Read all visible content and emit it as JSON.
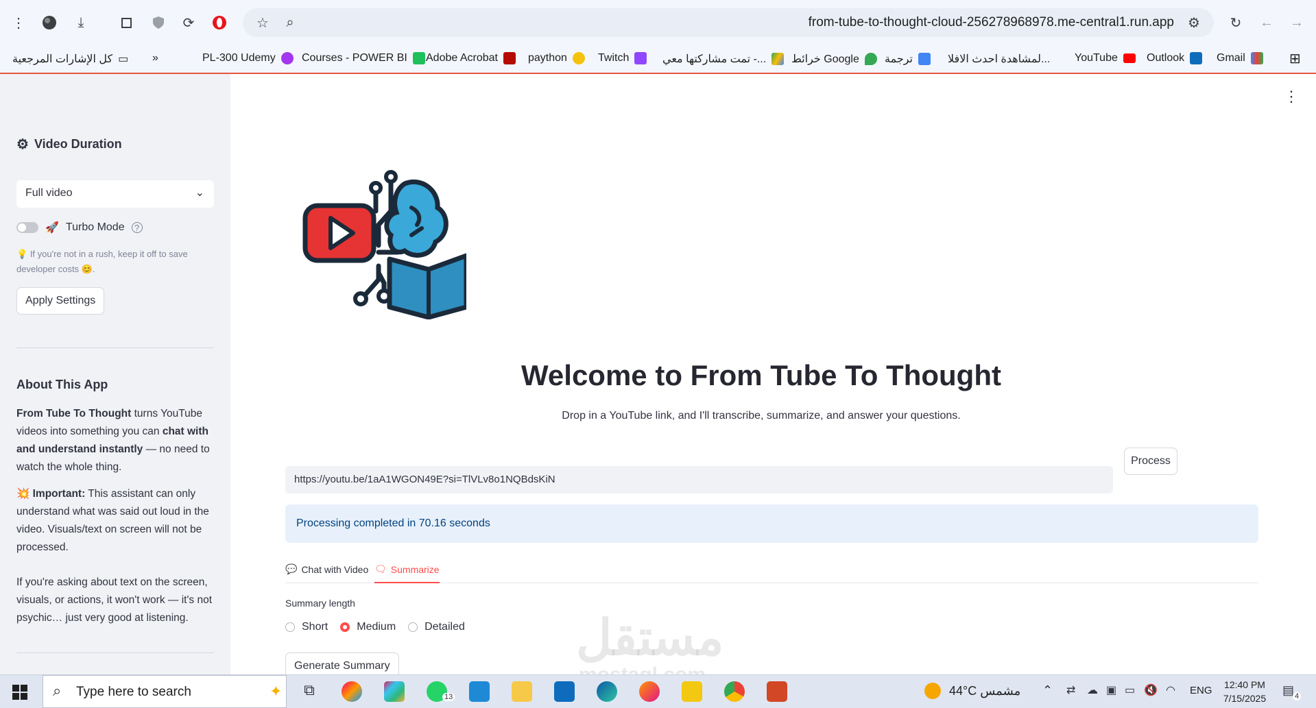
{
  "browser": {
    "url": "from-tube-to-thought-cloud-256278968978.me-central1.run.app",
    "bookmarks": [
      {
        "label": "Gmail",
        "color": "#ea4335"
      },
      {
        "label": "Outlook",
        "color": "#0f6cbd"
      },
      {
        "label": "YouTube",
        "color": "#ff0000"
      },
      {
        "label": "لمشاهدة احدث الافلا...",
        "color": ""
      },
      {
        "label": "ترجمة",
        "color": "#4285f4"
      },
      {
        "label": "خرائط Google",
        "color": "#34a853"
      },
      {
        "label": "تمت مشاركتها معي -...",
        "color": "#fbbc04"
      },
      {
        "label": "Twitch",
        "color": "#9146ff"
      },
      {
        "label": "paython",
        "color": "#f4c20d"
      },
      {
        "label": "Adobe Acrobat",
        "color": "#b30b00"
      },
      {
        "label": "Courses - POWER BI",
        "color": "#1fbf5b"
      },
      {
        "label": "PL-300 Udemy",
        "color": "#a435f0"
      }
    ],
    "all_bookmarks_label": "كل الإشارات المرجعية"
  },
  "sidebar": {
    "duration_title": "Video Duration",
    "duration_value": "Full video",
    "turbo_label": "Turbo Mode",
    "turbo_hint": "If you're not in a rush, keep it off to save developer costs",
    "apply_label": "Apply Settings",
    "about_title": "About This App",
    "about_p1_bold": "From Tube To Thought",
    "about_p1_a": " turns YouTube videos into something you can ",
    "about_p1_bold2": "chat with and understand instantly",
    "about_p1_b": " — no need to watch the whole thing.",
    "about_p2_bold": "Important:",
    "about_p2": " This assistant can only understand what was said out loud in the video. Visuals/text on screen will not be processed.",
    "about_p3": "If you're asking about text on the screen, visuals, or actions, it won't work — it's not psychic… just very good at listening."
  },
  "main": {
    "welcome": "Welcome to From Tube To Thought",
    "subtitle": "Drop in a YouTube link, and I'll transcribe, summarize, and answer your questions.",
    "url_value": "https://youtu.be/1aA1WGON49E?si=TlVLv8o1NQBdsKiN",
    "process_label": "Process",
    "success": "Processing completed in 70.16 seconds",
    "tabs": [
      {
        "label": "Chat with Video",
        "active": false
      },
      {
        "label": "Summarize",
        "active": true
      }
    ],
    "summary_length_label": "Summary length",
    "radio_options": [
      {
        "label": "Short",
        "selected": false
      },
      {
        "label": "Medium",
        "selected": true
      },
      {
        "label": "Detailed",
        "selected": false
      }
    ],
    "generate_label": "Generate Summary",
    "watermark": "مستقل",
    "watermark_sub": "mostaql.com"
  },
  "taskbar": {
    "search_placeholder": "Type here to search",
    "weather": "44°C مشمس",
    "lang": "ENG",
    "time": "12:40 PM",
    "date": "7/15/2025",
    "notification_count": "4",
    "whatsapp_badge": "13"
  },
  "colors": {
    "accent": "#ff4b4b",
    "sidebar_bg": "#f0f2f6",
    "info_bg": "#e8f1fb"
  }
}
